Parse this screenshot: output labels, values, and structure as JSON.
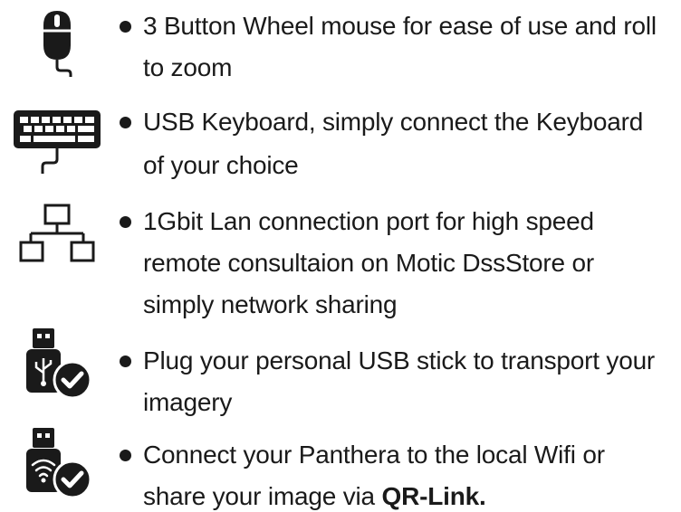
{
  "features": [
    {
      "icon": "mouse-icon",
      "lines": [
        "3 Button Wheel mouse for ease of use and roll",
        "to zoom"
      ]
    },
    {
      "icon": "keyboard-icon",
      "lines": [
        "USB Keyboard, simply connect the Keyboard",
        "of your choice"
      ]
    },
    {
      "icon": "network-icon",
      "lines": [
        "1Gbit Lan connection port for high speed",
        "remote consultaion on Motic DssStore or",
        "simply network sharing"
      ]
    },
    {
      "icon": "usb-stick-check-icon",
      "lines": [
        "Plug your personal USB stick to transport your",
        "imagery"
      ]
    },
    {
      "icon": "wifi-usb-check-icon",
      "lines": [
        "Connect your Panthera to the local Wifi or",
        "share your image via "
      ],
      "emphasis": "QR-Link."
    }
  ]
}
